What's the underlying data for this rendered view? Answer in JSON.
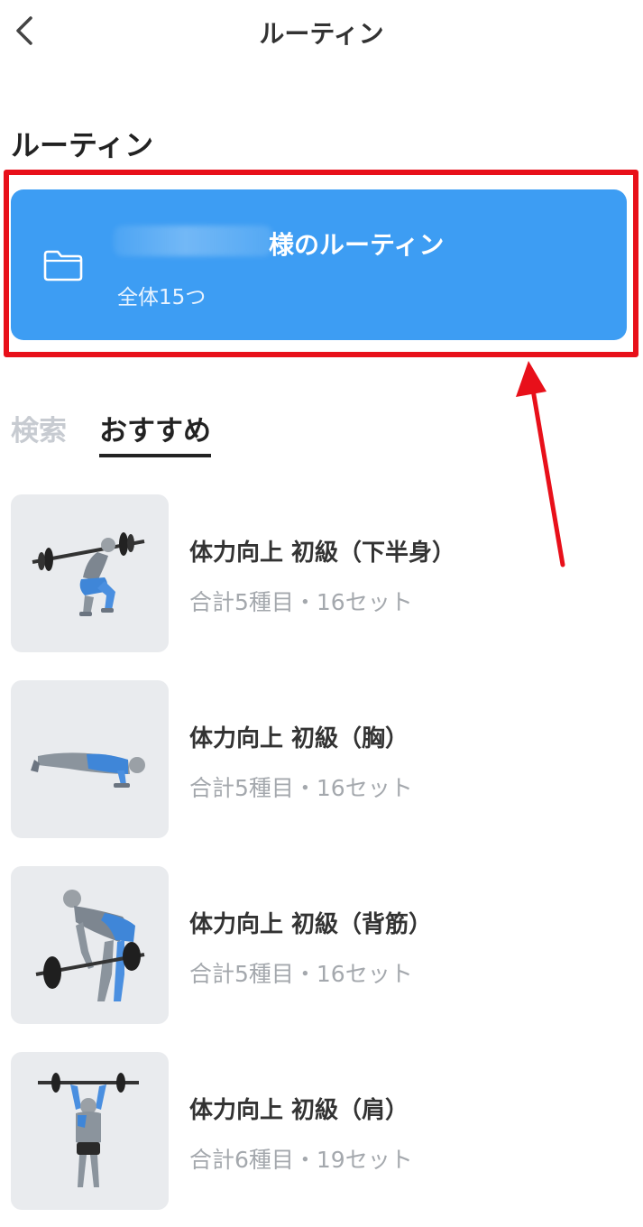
{
  "nav": {
    "title": "ルーティン",
    "back_icon": "chevron-left-icon"
  },
  "section": {
    "title": "ルーティン"
  },
  "folder": {
    "title_suffix": "様のルーティン",
    "count_label": "全体15つ",
    "icon": "folder-icon",
    "color": "#3d9df3"
  },
  "annotation": {
    "highlight_color": "#e8101a"
  },
  "tabs": [
    {
      "label": "検索",
      "active": false
    },
    {
      "label": "おすすめ",
      "active": true
    }
  ],
  "routines": [
    {
      "title": "体力向上 初級（下半身）",
      "summary": "合計5種目・16セット",
      "thumbnail": "squat-exercise-illustration"
    },
    {
      "title": "体力向上 初級（胸）",
      "summary": "合計5種目・16セット",
      "thumbnail": "push-up-exercise-illustration"
    },
    {
      "title": "体力向上 初級（背筋）",
      "summary": "合計5種目・16セット",
      "thumbnail": "barbell-row-exercise-illustration"
    },
    {
      "title": "体力向上 初級（肩）",
      "summary": "合計6種目・19セット",
      "thumbnail": "overhead-press-exercise-illustration"
    }
  ]
}
